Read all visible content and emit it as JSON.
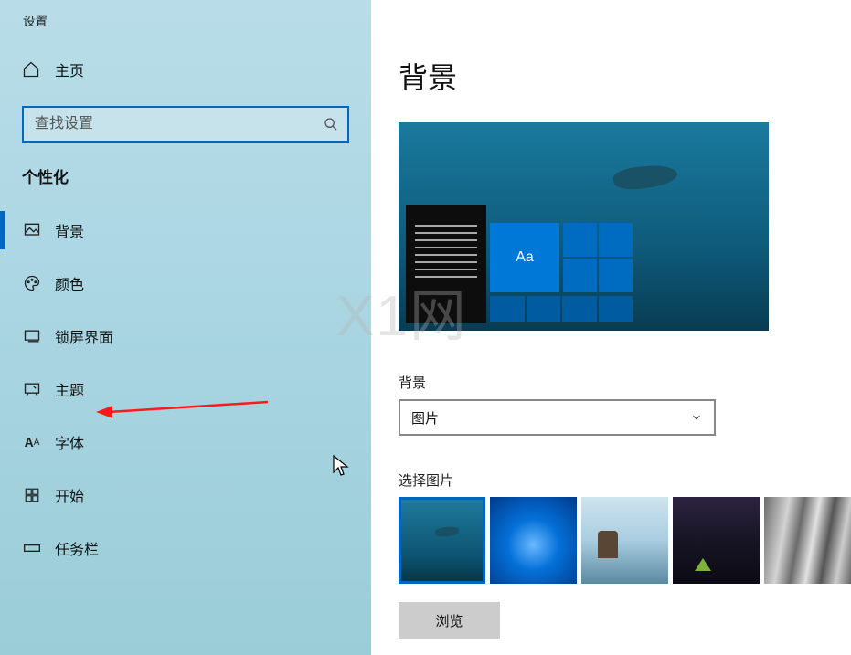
{
  "app_title": "设置",
  "home_label": "主页",
  "search": {
    "placeholder": "查找设置"
  },
  "section_title": "个性化",
  "nav": [
    {
      "key": "background",
      "label": "背景",
      "active": true
    },
    {
      "key": "colors",
      "label": "颜色",
      "active": false
    },
    {
      "key": "lockscreen",
      "label": "锁屏界面",
      "active": false
    },
    {
      "key": "themes",
      "label": "主题",
      "active": false
    },
    {
      "key": "fonts",
      "label": "字体",
      "active": false
    },
    {
      "key": "start",
      "label": "开始",
      "active": false
    },
    {
      "key": "taskbar",
      "label": "任务栏",
      "active": false
    }
  ],
  "page_heading": "背景",
  "preview_tile_text": "Aa",
  "bg_field_label": "背景",
  "bg_dropdown_value": "图片",
  "choose_image_label": "选择图片",
  "browse_label": "浏览",
  "watermark": "X1网"
}
